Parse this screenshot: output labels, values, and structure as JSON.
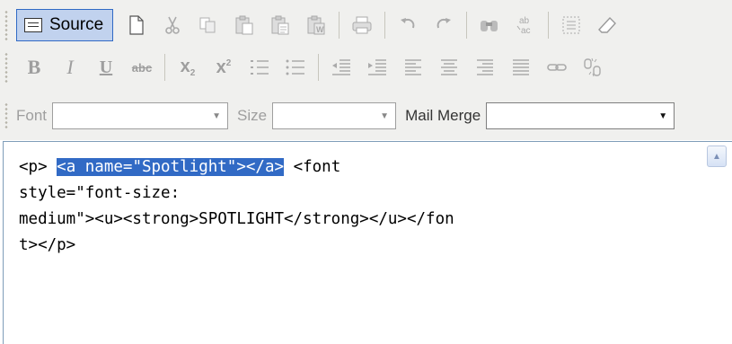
{
  "toolbar": {
    "source_label": "Source",
    "row1_icons": [
      "new-page-icon",
      "cut-icon",
      "copy-icon",
      "paste-icon",
      "paste-text-icon",
      "paste-word-icon",
      "print-icon",
      "undo-icon",
      "redo-icon",
      "find-icon",
      "replace-icon",
      "select-all-icon",
      "remove-format-icon"
    ],
    "format": {
      "bold": "B",
      "italic": "I",
      "underline": "U",
      "strike": "abc",
      "subscript_base": "x",
      "subscript_mark": "2",
      "superscript_base": "x",
      "superscript_mark": "2"
    },
    "font_label": "Font",
    "font_value": "",
    "size_label": "Size",
    "size_value": "",
    "mailmerge_label": "Mail Merge",
    "mailmerge_value": ""
  },
  "editor": {
    "line1_pre": "<p> ",
    "line1_selected": "<a name=\"Spotlight\"></a>",
    "line1_post": " <font",
    "line2": "style=\"font-size:",
    "line3": "medium\"><u><strong>SPOTLIGHT</strong></u></fon",
    "line4": "t></p>"
  },
  "colors": {
    "toolbar_bg": "#f0f0ee",
    "selection": "#316ac5",
    "source_active_bg": "#c1d2ee"
  }
}
